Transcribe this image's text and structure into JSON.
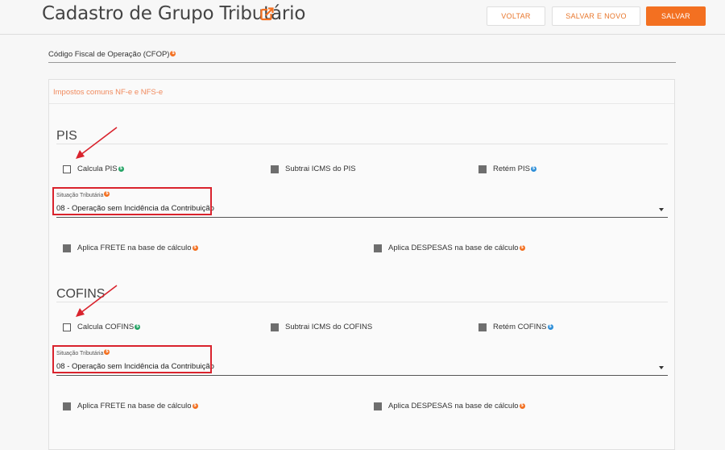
{
  "header": {
    "title": "Cadastro de Grupo Tributário",
    "title_icon": "external-link-icon",
    "buttons": {
      "voltar": "VOLTAR",
      "salvar_novo": "SALVAR E NOVO",
      "salvar": "SALVAR"
    }
  },
  "cfop": {
    "label": "Código Fiscal de Operação (CFOP)",
    "badge": "$",
    "value": ""
  },
  "panel": {
    "title": "Impostos comuns NF-e e NFS-e"
  },
  "pis": {
    "title": "PIS",
    "calcula": {
      "label": "Calcula PIS",
      "badge": "$",
      "checked": false
    },
    "subtrai": {
      "label": "Subtrai ICMS do PIS",
      "checked": true
    },
    "retem": {
      "label": "Retém PIS",
      "badge": "$",
      "checked": true
    },
    "situacao": {
      "label": "Situação Tributária",
      "badge": "$",
      "value": "08 - Operação sem Incidência da Contribuição"
    },
    "frete": {
      "label": "Aplica FRETE na base de cálculo",
      "badge": "$",
      "checked": true
    },
    "despesas": {
      "label": "Aplica DESPESAS na base de cálculo",
      "badge": "$",
      "checked": true
    }
  },
  "cofins": {
    "title": "COFINS",
    "calcula": {
      "label": "Calcula COFINS",
      "badge": "$",
      "checked": false
    },
    "subtrai": {
      "label": "Subtrai ICMS do COFINS",
      "checked": true
    },
    "retem": {
      "label": "Retém COFINS",
      "badge": "$",
      "checked": true
    },
    "situacao": {
      "label": "Situação Tributária",
      "badge": "$",
      "value": "08 - Operação sem Incidência da Contribuição"
    },
    "frete": {
      "label": "Aplica FRETE na base de cálculo",
      "badge": "$",
      "checked": true
    },
    "despesas": {
      "label": "Aplica DESPESAS na base de cálculo",
      "badge": "$",
      "checked": true
    }
  },
  "colors": {
    "accent": "#f37021",
    "highlight": "#d9232d",
    "badge_green": "#27a567",
    "badge_blue": "#2f8fd8"
  }
}
